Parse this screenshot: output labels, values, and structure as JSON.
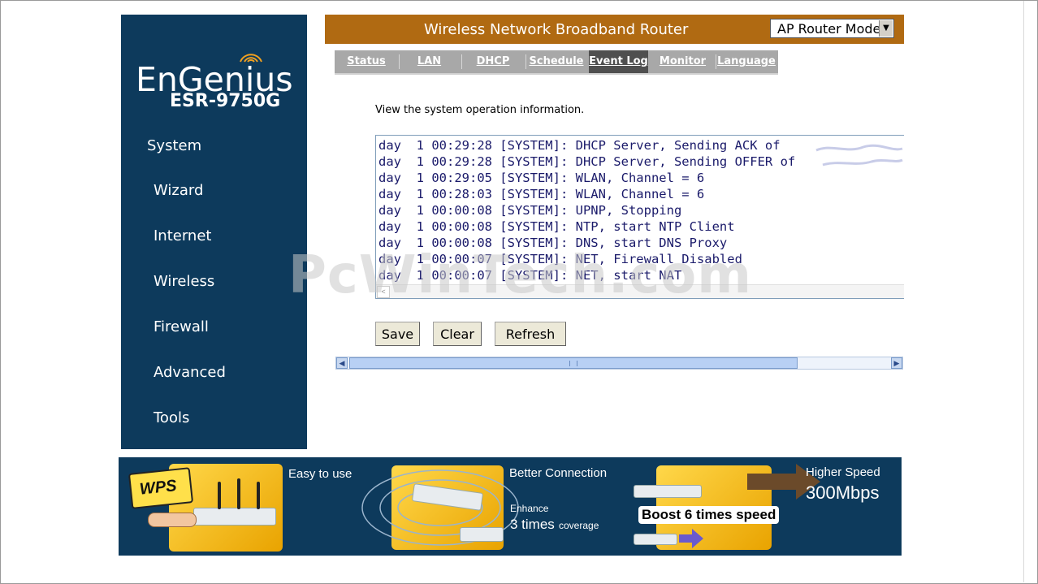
{
  "sidebar": {
    "brand": "EnGenius",
    "model": "ESR-9750G",
    "items": [
      {
        "label": "System"
      },
      {
        "label": "Wizard"
      },
      {
        "label": "Internet"
      },
      {
        "label": "Wireless"
      },
      {
        "label": "Firewall"
      },
      {
        "label": "Advanced"
      },
      {
        "label": "Tools"
      }
    ]
  },
  "header": {
    "title": "Wireless Network Broadband Router",
    "mode_select": {
      "selected": "AP Router Mode"
    }
  },
  "tabs": [
    {
      "label": "Status"
    },
    {
      "label": "LAN"
    },
    {
      "label": "DHCP"
    },
    {
      "label": "Schedule"
    },
    {
      "label": "Event Log",
      "active": true
    },
    {
      "label": "Monitor"
    },
    {
      "label": "Language"
    }
  ],
  "main": {
    "description": "View the system operation information.",
    "log_lines": [
      "day  1 00:29:28 [SYSTEM]: DHCP Server, Sending ACK of",
      "day  1 00:29:28 [SYSTEM]: DHCP Server, Sending OFFER of",
      "day  1 00:29:05 [SYSTEM]: WLAN, Channel = 6",
      "day  1 00:28:03 [SYSTEM]: WLAN, Channel = 6",
      "day  1 00:00:08 [SYSTEM]: UPNP, Stopping",
      "day  1 00:00:08 [SYSTEM]: NTP, start NTP Client",
      "day  1 00:00:08 [SYSTEM]: DNS, start DNS Proxy",
      "day  1 00:00:07 [SYSTEM]: NET, Firewall Disabled",
      "day  1 00:00:07 [SYSTEM]: NET, start NAT"
    ],
    "buttons": {
      "save": "Save",
      "clear": "Clear",
      "refresh": "Refresh"
    }
  },
  "watermark": "PcWinTech.com",
  "banner": {
    "wps_label": "WPS",
    "easy": "Easy to use",
    "better": "Better Connection",
    "enhance": "Enhance",
    "times3": "3 times",
    "coverage": "coverage",
    "boost": "Boost 6 times speed",
    "higher": "Higher Speed",
    "speed": "300Mbps"
  },
  "colors": {
    "sidebar_bg": "#0d3a5c",
    "header_bg": "#b06a12",
    "tab_bg": "#a8a8a8",
    "tab_active_bg": "#4f4f4f"
  }
}
